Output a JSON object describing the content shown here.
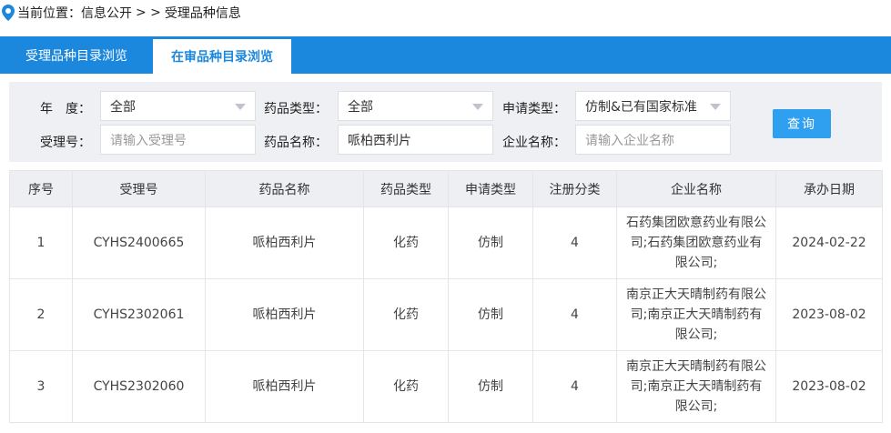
{
  "breadcrumb": {
    "prefix": "当前位置：",
    "section": "信息公开",
    "sep": "> >",
    "current": "受理品种信息"
  },
  "tabs": [
    {
      "label": "受理品种目录浏览",
      "active": false
    },
    {
      "label": "在审品种目录浏览",
      "active": true
    }
  ],
  "filters": {
    "year": {
      "label": "年　度：",
      "value": "全部"
    },
    "drug_type": {
      "label": "药品类型：",
      "value": "全部"
    },
    "apply_type": {
      "label": "申请类型：",
      "value": "仿制&已有国家标准"
    },
    "accept_no": {
      "label": "受理号：",
      "placeholder": "请输入受理号"
    },
    "drug_name": {
      "label": "药品名称：",
      "value": "哌柏西利片"
    },
    "company": {
      "label": "企业名称：",
      "placeholder": "请输入企业名称"
    },
    "query_label": "查询"
  },
  "table": {
    "headers": [
      "序号",
      "受理号",
      "药品名称",
      "药品类型",
      "申请类型",
      "注册分类",
      "企业名称",
      "承办日期"
    ],
    "rows": [
      [
        "1",
        "CYHS2400665",
        "哌柏西利片",
        "化药",
        "仿制",
        "4",
        "石药集团欧意药业有限公司;石药集团欧意药业有限公司;",
        "2024-02-22"
      ],
      [
        "2",
        "CYHS2302061",
        "哌柏西利片",
        "化药",
        "仿制",
        "4",
        "南京正大天晴制药有限公司;南京正大天晴制药有限公司;",
        "2023-08-02"
      ],
      [
        "3",
        "CYHS2302060",
        "哌柏西利片",
        "化药",
        "仿制",
        "4",
        "南京正大天晴制药有限公司;南京正大天晴制药有限公司;",
        "2023-08-02"
      ]
    ]
  },
  "colors": {
    "accent": "#1b87dd",
    "button": "#2ea0ef"
  }
}
